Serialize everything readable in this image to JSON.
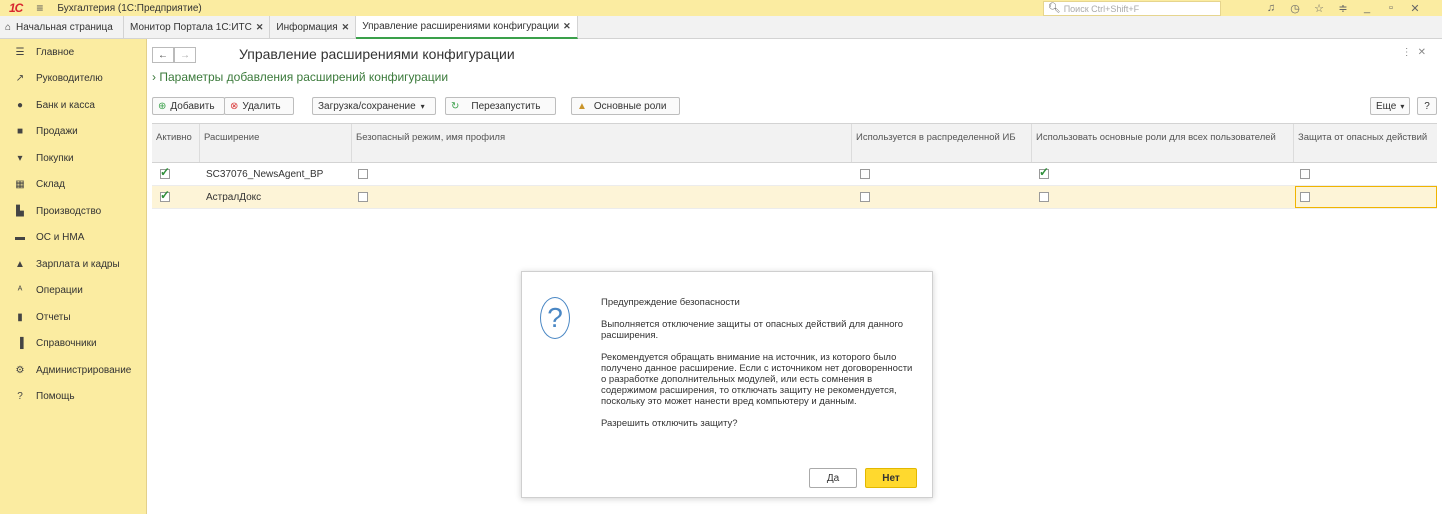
{
  "topbar": {
    "logo": "1С",
    "title": "Бухгалтерия  (1С:Предприятие)",
    "search_placeholder": "Поиск Ctrl+Shift+F",
    "icons": [
      "bell-icon",
      "history-icon",
      "star-icon",
      "settings-lines-icon",
      "minimize-icon",
      "restore-icon",
      "close-icon"
    ]
  },
  "tabs": [
    {
      "label": "Начальная страница",
      "closable": false
    },
    {
      "label": "Монитор Портала 1С:ИТС",
      "closable": true
    },
    {
      "label": "Информация",
      "closable": true
    },
    {
      "label": "Управление расширениями конфигурации",
      "closable": true,
      "active": true
    }
  ],
  "sidebar": {
    "items": [
      {
        "label": "Главное",
        "icon": "menu-lines-icon"
      },
      {
        "label": "Руководителю",
        "icon": "trend-icon"
      },
      {
        "label": "Банк и касса",
        "icon": "coin-icon"
      },
      {
        "label": "Продажи",
        "icon": "bag-icon"
      },
      {
        "label": "Покупки",
        "icon": "cart-icon"
      },
      {
        "label": "Склад",
        "icon": "warehouse-icon"
      },
      {
        "label": "Производство",
        "icon": "factory-icon"
      },
      {
        "label": "ОС и НМА",
        "icon": "truck-icon"
      },
      {
        "label": "Зарплата и кадры",
        "icon": "person-icon"
      },
      {
        "label": "Операции",
        "icon": "operations-icon"
      },
      {
        "label": "Отчеты",
        "icon": "bar-chart-icon"
      },
      {
        "label": "Справочники",
        "icon": "book-icon"
      },
      {
        "label": "Администрирование",
        "icon": "gear-icon"
      },
      {
        "label": "Помощь",
        "icon": "question-icon"
      }
    ]
  },
  "page": {
    "title": "Управление расширениями конфигурации",
    "params_link": "Параметры добавления расширений конфигурации"
  },
  "toolbar": {
    "add": "Добавить",
    "delete": "Удалить",
    "load_save": "Загрузка/сохранение",
    "restart": "Перезапустить",
    "main_roles": "Основные роли",
    "more": "Еще",
    "help": "?"
  },
  "table": {
    "columns": [
      "Активно",
      "Расширение",
      "Безопасный режим, имя профиля",
      "Используется в распределенной ИБ",
      "Использовать основные роли для всех пользователей",
      "Защита от опасных действий"
    ],
    "rows": [
      {
        "active": true,
        "name": "SC37076_NewsAgent_BP",
        "safe_mode": false,
        "distributed": false,
        "main_roles": true,
        "protection": false
      },
      {
        "active": true,
        "name": "АстралДокс",
        "safe_mode": false,
        "distributed": false,
        "main_roles": false,
        "protection": false
      }
    ]
  },
  "dialog": {
    "heading": "Предупреждение безопасности",
    "p1": "Выполняется отключение защиты от опасных действий для данного расширения.",
    "p2": "Рекомендуется обращать внимание на источник, из которого было получено данное расширение. Если с источником нет договоренности о разработке дополнительных модулей, или есть сомнения в содержимом расширения, то отключать защиту не рекомендуется, поскольку это может нанести вред компьютеру и данным.",
    "question": "Разрешить отключить защиту?",
    "yes": "Да",
    "no": "Нет"
  }
}
